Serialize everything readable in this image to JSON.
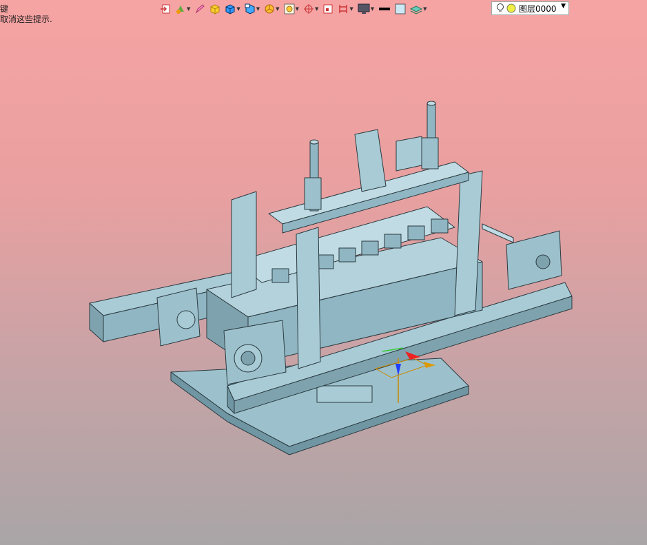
{
  "hint": {
    "line1": "键",
    "line2": "取消这些提示."
  },
  "toolbar": {
    "icons": [
      "exit-icon",
      "paint-icon",
      "pencil-icon",
      "box-yellow-icon",
      "box-blue-icon",
      "box-view-icon",
      "pie-icon",
      "snapshot-icon",
      "crosshair-icon",
      "frame-icon",
      "bracket-icon",
      "monitor-icon",
      "line-icon",
      "swatch-icon",
      "layers-icon"
    ],
    "layer_label": "图层0000"
  },
  "colors": {
    "bg_top": "#f6a3a3",
    "bg_bottom": "#a9a5a7",
    "model": "#8fb6c2",
    "model_edge": "#2b3a40"
  }
}
